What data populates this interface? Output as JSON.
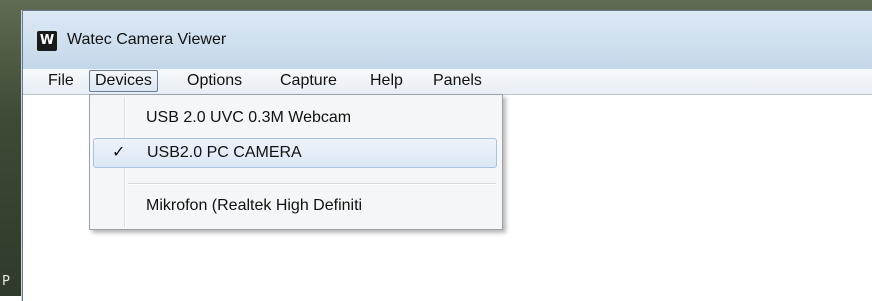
{
  "desktop": {
    "label": "P"
  },
  "window": {
    "icon_text": "W",
    "title": "Watec Camera Viewer"
  },
  "menubar": {
    "items": [
      {
        "label": "File"
      },
      {
        "label": "Devices"
      },
      {
        "label": "Options"
      },
      {
        "label": "Capture"
      },
      {
        "label": "Help"
      },
      {
        "label": "Panels"
      }
    ]
  },
  "devices_menu": {
    "items": [
      {
        "label": "USB 2.0 UVC 0.3M Webcam",
        "checked": false
      },
      {
        "label": "USB2.0 PC CAMERA",
        "checked": true,
        "check_glyph": "✓"
      },
      {
        "label": "Mikrofon (Realtek High Definiti",
        "checked": false
      }
    ]
  }
}
